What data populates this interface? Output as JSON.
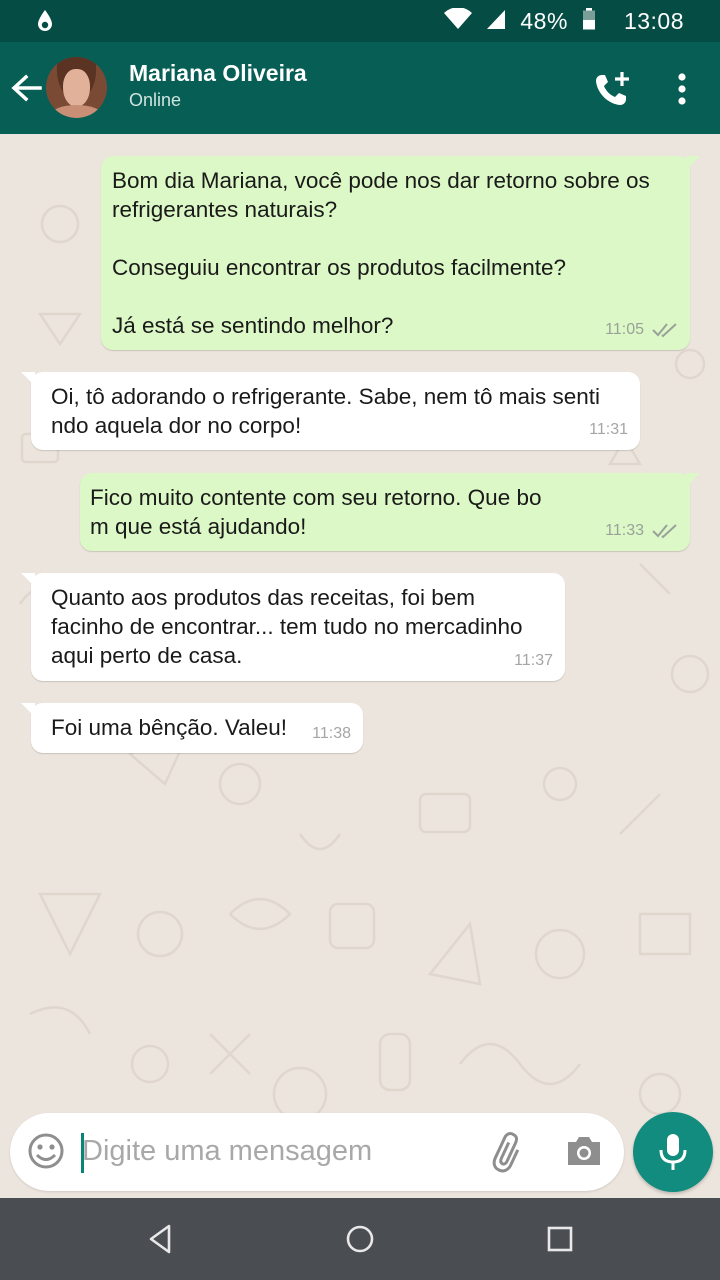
{
  "status_bar": {
    "battery": "48%",
    "time": "13:08",
    "icons": [
      "notification-drop-icon",
      "wifi-icon",
      "signal-icon",
      "battery-icon"
    ]
  },
  "header": {
    "contact_name": "Mariana Oliveira",
    "contact_status": "Online",
    "icons": [
      "back-arrow-icon",
      "avatar",
      "add-call-icon",
      "more-vert-icon"
    ],
    "colors": {
      "status_bar": "#054d44",
      "toolbar": "#075e54"
    }
  },
  "messages": [
    {
      "direction": "outgoing",
      "text": "Bom dia Mariana, você pode nos dar retorno sobre os\nrefrigerantes naturais?\n\nConseguiu encontrar os produtos facilmente?\n\nJá está se sentindo melhor?",
      "time": "11:05",
      "status": "read"
    },
    {
      "direction": "incoming",
      "text": "Oi, tô adorando o refrigerante. Sabe, nem tô mais senti\nndo aquela dor no corpo!",
      "time": "11:31"
    },
    {
      "direction": "outgoing",
      "text": "Fico muito contente com seu retorno. Que bo\nm que está ajudando!",
      "time": "11:33",
      "status": "read"
    },
    {
      "direction": "incoming",
      "text": "Quanto aos produtos das receitas, foi bem\nfacinho de encontrar... tem tudo no mercadinho\naqui perto de casa.",
      "time": "11:37"
    },
    {
      "direction": "incoming",
      "text": "Foi uma bênção. Valeu!",
      "time": "11:38"
    }
  ],
  "composer": {
    "placeholder": "Digite uma mensagem",
    "icons": [
      "emoji-icon",
      "attach-icon",
      "camera-icon",
      "mic-icon"
    ],
    "accent": "#128c7e"
  },
  "colors": {
    "outgoing_bubble": "#dcf8c6",
    "incoming_bubble": "#ffffff",
    "chat_background": "#ece5dd"
  },
  "nav_bar": {
    "icons": [
      "back-triangle-icon",
      "home-circle-icon",
      "recents-square-icon"
    ]
  }
}
